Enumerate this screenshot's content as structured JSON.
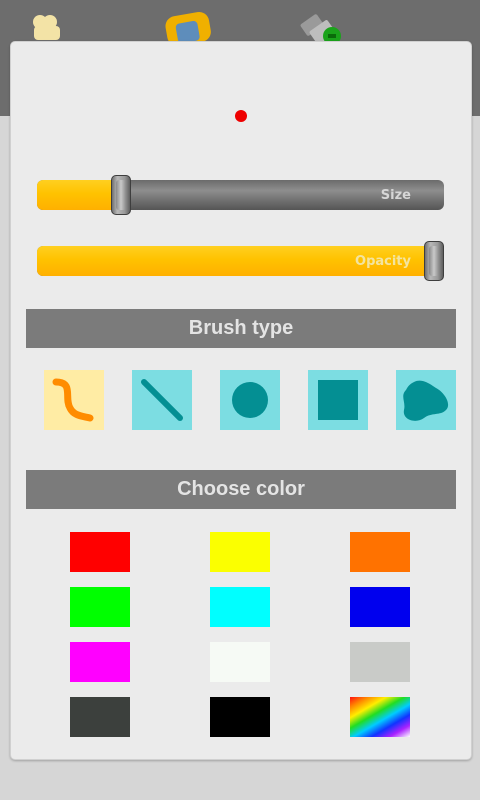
{
  "top_bar": {
    "icons": [
      "bone-icon",
      "puzzle-icon",
      "usb-plus-icon"
    ]
  },
  "brush_panel": {
    "preview_color": "#ee0000",
    "size_slider": {
      "label": "Size",
      "value": 0.19
    },
    "opacity_slider": {
      "label": "Opacity",
      "value": 1.0
    },
    "brush_type_title": "Brush type",
    "brush_types": [
      {
        "icon": "freehand-brush-icon",
        "selected": true
      },
      {
        "icon": "line-brush-icon",
        "selected": false
      },
      {
        "icon": "circle-brush-icon",
        "selected": false
      },
      {
        "icon": "square-brush-icon",
        "selected": false
      },
      {
        "icon": "blob-brush-icon",
        "selected": false
      }
    ],
    "choose_color_title": "Choose color",
    "colors": [
      "#ff0000",
      "#fbff00",
      "#ff7200",
      "#00ff00",
      "#00ffff",
      "#0000ee",
      "#ff00ff",
      "#f6faf5",
      "#c9cbc8",
      "#3c403d",
      "#000000",
      "rainbow"
    ]
  }
}
